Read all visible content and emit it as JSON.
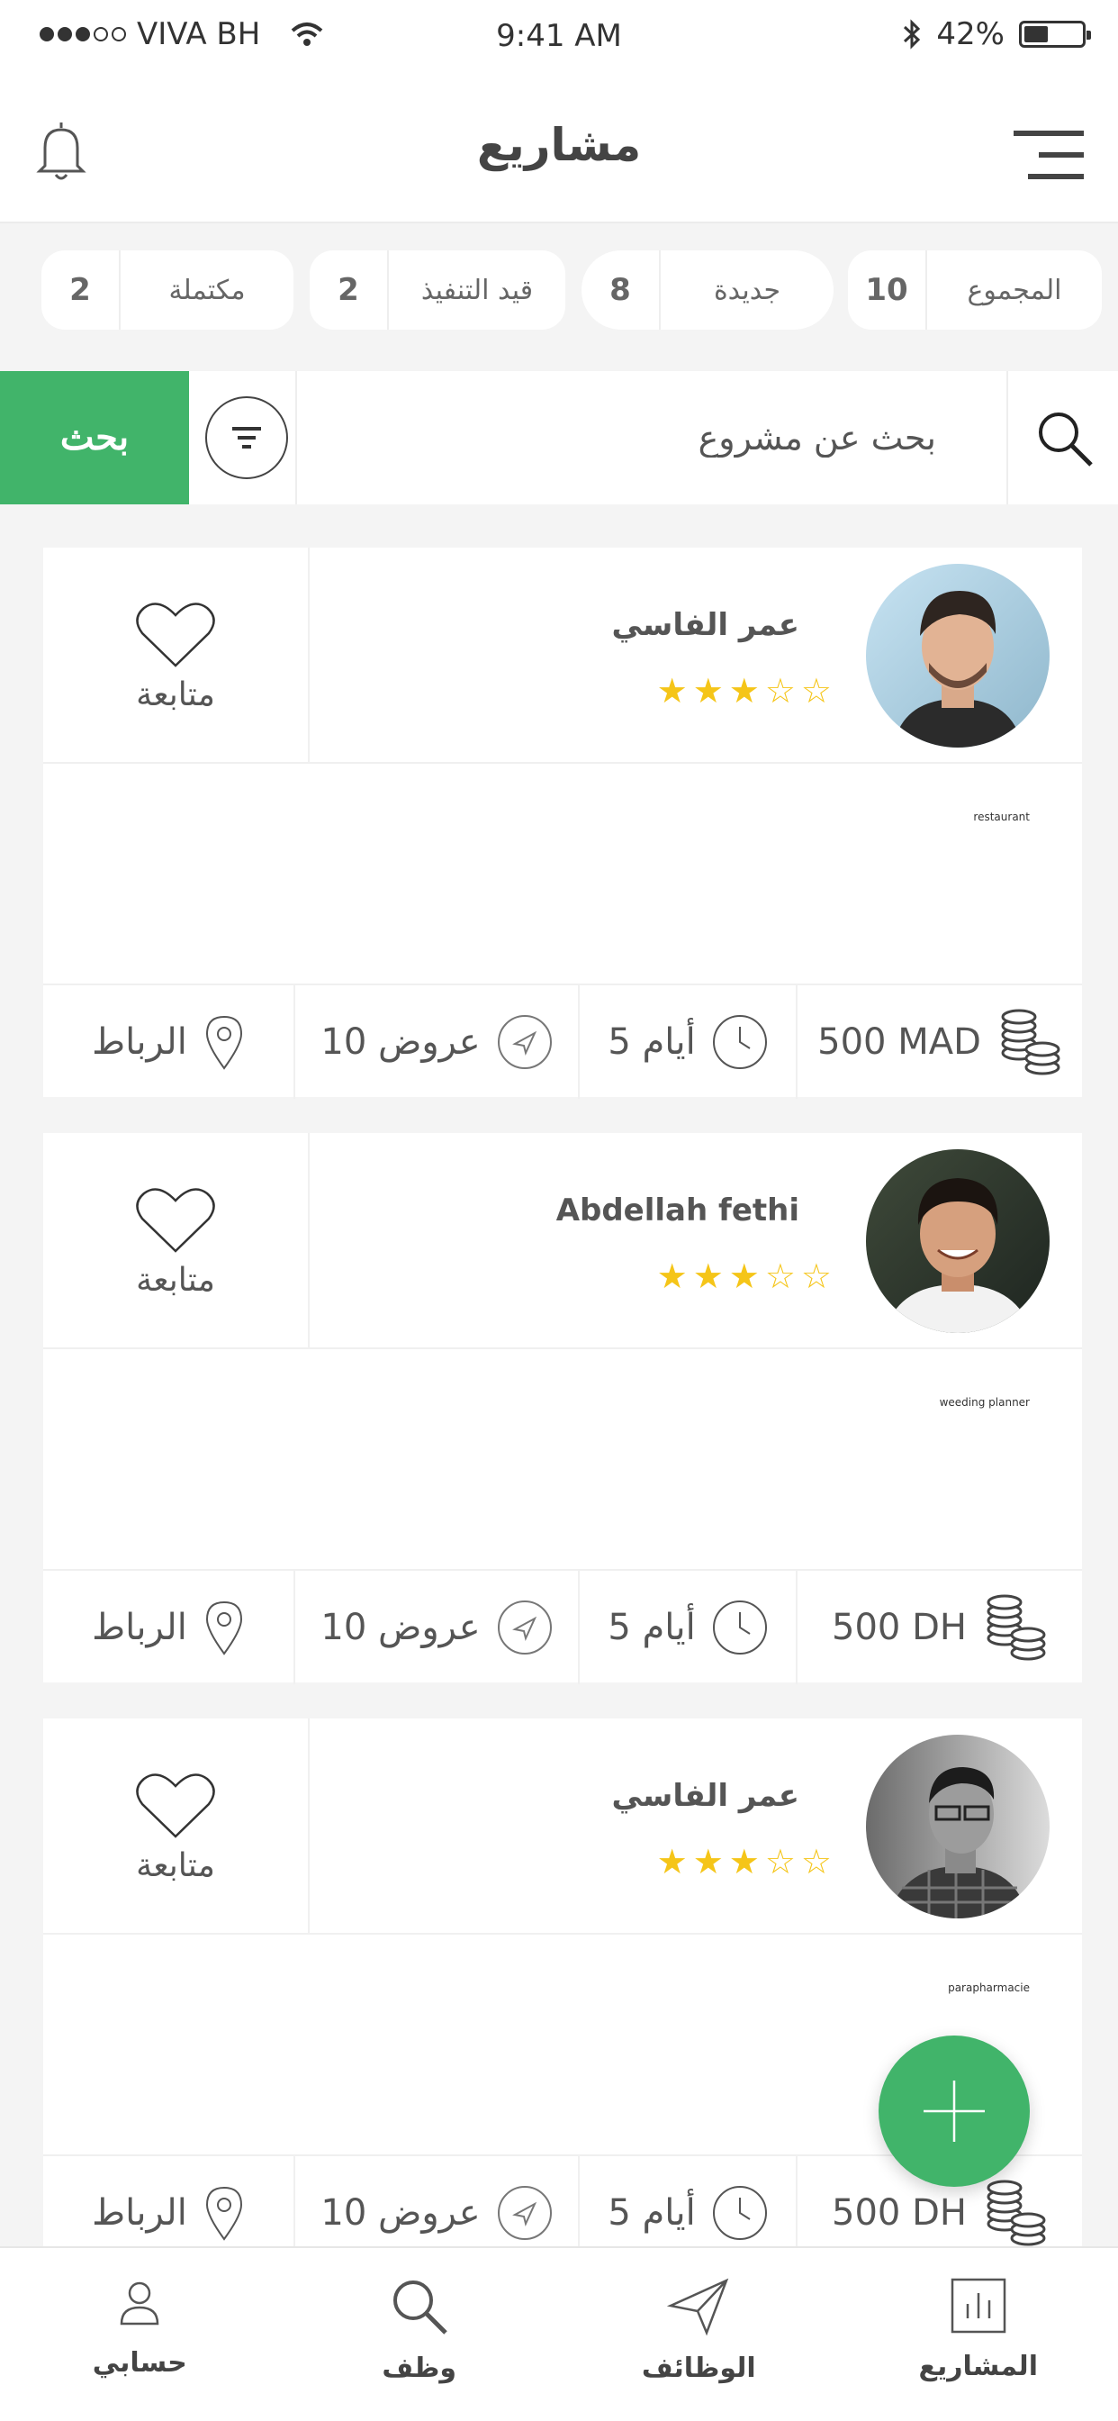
{
  "status_bar": {
    "carrier": "VIVA BH",
    "time": "9:41 AM",
    "battery": "42%",
    "battery_level": 0.42
  },
  "header": {
    "title": "مشاريع"
  },
  "stats": [
    {
      "label": "المجموع",
      "count": "10"
    },
    {
      "label": "جديدة",
      "count": "8"
    },
    {
      "label": "قيد التنفيذ",
      "count": "2"
    },
    {
      "label": "مكتملة",
      "count": "2"
    }
  ],
  "search": {
    "placeholder": "بحث عن مشروع",
    "button_label": "بحث"
  },
  "projects": [
    {
      "user_name": "عمر الفاسي",
      "rating": 3,
      "follow_label": "متابعة",
      "category": "restaurant",
      "price": "500 MAD",
      "days": "5 أيام",
      "offers": "10 عروض",
      "location": "الرباط"
    },
    {
      "user_name": "Abdellah fethi",
      "rating": 3,
      "follow_label": "متابعة",
      "category": "weeding planner",
      "price": "500 DH",
      "days": "5 أيام",
      "offers": "10 عروض",
      "location": "الرباط"
    },
    {
      "user_name": "عمر الفاسي",
      "rating": 3,
      "follow_label": "متابعة",
      "category": "parapharmacie",
      "price": "500 DH",
      "days": "5 أيام",
      "offers": "10 عروض",
      "location": "الرباط"
    }
  ],
  "bottom_nav": [
    {
      "label": "حسابي",
      "icon": "user-icon"
    },
    {
      "label": "وظف",
      "icon": "search-icon"
    },
    {
      "label": "الوظائف",
      "icon": "send-icon"
    },
    {
      "label": "المشاريع",
      "icon": "chart-icon"
    }
  ],
  "colors": {
    "accent": "#41b46a",
    "star": "#f5c518"
  }
}
